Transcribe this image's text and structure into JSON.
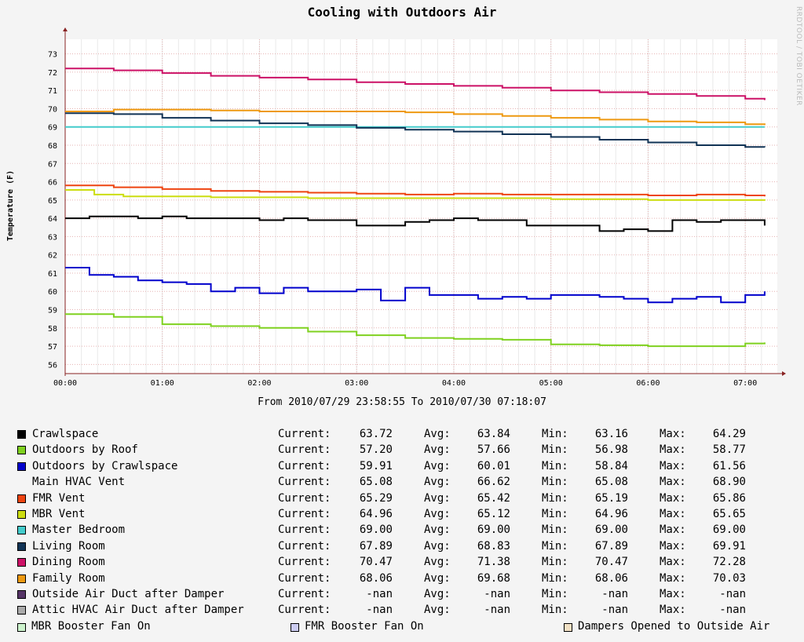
{
  "chart_data": {
    "type": "line",
    "title": "Cooling with Outdoors Air",
    "ylabel": "Temperature (F)",
    "xlabel": "",
    "ylim": [
      55.5,
      73.8
    ],
    "yticks": [
      56,
      57,
      58,
      59,
      60,
      61,
      62,
      63,
      64,
      65,
      66,
      67,
      68,
      69,
      70,
      71,
      72,
      73
    ],
    "xlim": [
      0,
      7.33
    ],
    "xticks": [
      {
        "label": "00:00",
        "value": 0
      },
      {
        "label": "01:00",
        "value": 1
      },
      {
        "label": "02:00",
        "value": 2
      },
      {
        "label": "03:00",
        "value": 3
      },
      {
        "label": "04:00",
        "value": 4
      },
      {
        "label": "05:00",
        "value": 5
      },
      {
        "label": "06:00",
        "value": 6
      },
      {
        "label": "07:00",
        "value": 7
      }
    ],
    "grid": true,
    "range_text": "From 2010/07/29 23:58:55 To 2010/07/30 07:18:07",
    "series": [
      {
        "name": "Crawlspace",
        "color": "#000000",
        "x": [
          0,
          0.25,
          0.5,
          0.75,
          1,
          1.25,
          1.5,
          1.75,
          2,
          2.25,
          2.5,
          2.75,
          3,
          3.25,
          3.5,
          3.75,
          4,
          4.25,
          4.5,
          4.75,
          5,
          5.25,
          5.5,
          5.75,
          6,
          6.25,
          6.5,
          6.75,
          7,
          7.2
        ],
        "y": [
          64.0,
          64.1,
          64.1,
          64.0,
          64.1,
          64.0,
          64.0,
          64.0,
          63.9,
          64.0,
          63.9,
          63.9,
          63.6,
          63.6,
          63.8,
          63.9,
          64.0,
          63.9,
          63.9,
          63.6,
          63.6,
          63.6,
          63.3,
          63.4,
          63.3,
          63.9,
          63.8,
          63.9,
          63.9,
          63.6
        ],
        "current": "63.72",
        "avg": "63.84",
        "min": "63.16",
        "max": "64.29"
      },
      {
        "name": "Outdoors by Roof",
        "color": "#7fd11f",
        "x": [
          0,
          0.5,
          1,
          1.5,
          2,
          2.5,
          3,
          3.5,
          4,
          4.5,
          5,
          5.5,
          6,
          6.5,
          7,
          7.2
        ],
        "y": [
          58.75,
          58.6,
          58.2,
          58.1,
          58.0,
          57.8,
          57.6,
          57.45,
          57.4,
          57.35,
          57.1,
          57.05,
          57.0,
          57.0,
          57.15,
          57.2
        ],
        "current": "57.20",
        "avg": "57.66",
        "min": "56.98",
        "max": "58.77"
      },
      {
        "name": "Outdoors by Crawlspace",
        "color": "#0000cc",
        "x": [
          0,
          0.25,
          0.5,
          0.75,
          1,
          1.25,
          1.5,
          1.75,
          2,
          2.25,
          2.5,
          2.75,
          3,
          3.25,
          3.5,
          3.75,
          4,
          4.25,
          4.5,
          4.75,
          5,
          5.25,
          5.5,
          5.75,
          6,
          6.25,
          6.5,
          6.75,
          7,
          7.2
        ],
        "y": [
          61.3,
          60.9,
          60.8,
          60.6,
          60.5,
          60.4,
          60.0,
          60.2,
          59.9,
          60.2,
          60.0,
          60.0,
          60.1,
          59.5,
          60.2,
          59.8,
          59.8,
          59.6,
          59.7,
          59.6,
          59.8,
          59.8,
          59.7,
          59.6,
          59.4,
          59.6,
          59.7,
          59.4,
          59.8,
          60.0
        ],
        "current": "59.91",
        "avg": "60.01",
        "min": "58.84",
        "max": "61.56"
      },
      {
        "name": "Main HVAC Vent",
        "color": "",
        "x": [],
        "y": [],
        "current": "65.08",
        "avg": "66.62",
        "min": "65.08",
        "max": "68.90"
      },
      {
        "name": "FMR Vent",
        "color": "#ee4411",
        "x": [
          0,
          0.5,
          1,
          1.5,
          2,
          2.5,
          3,
          3.5,
          4,
          4.5,
          5,
          5.5,
          6,
          6.5,
          7,
          7.2
        ],
        "y": [
          65.8,
          65.7,
          65.6,
          65.5,
          65.45,
          65.4,
          65.35,
          65.3,
          65.35,
          65.3,
          65.3,
          65.3,
          65.25,
          65.3,
          65.25,
          65.2
        ],
        "current": "65.29",
        "avg": "65.42",
        "min": "65.19",
        "max": "65.86"
      },
      {
        "name": "MBR Vent",
        "color": "#ccdd11",
        "x": [
          0,
          0.3,
          0.6,
          1,
          1.5,
          2,
          2.5,
          3,
          3.5,
          4,
          4.5,
          5,
          5.5,
          6,
          6.5,
          7,
          7.2
        ],
        "y": [
          65.55,
          65.3,
          65.2,
          65.2,
          65.15,
          65.15,
          65.1,
          65.1,
          65.1,
          65.1,
          65.1,
          65.05,
          65.05,
          65.0,
          65.0,
          65.0,
          64.96
        ],
        "current": "64.96",
        "avg": "65.12",
        "min": "64.96",
        "max": "65.65"
      },
      {
        "name": "Master Bedroom",
        "color": "#44cccc",
        "x": [
          0,
          7.2
        ],
        "y": [
          69.0,
          69.0
        ],
        "current": "69.00",
        "avg": "69.00",
        "min": "69.00",
        "max": "69.00"
      },
      {
        "name": "Living Room",
        "color": "#113355",
        "x": [
          0,
          0.5,
          1,
          1.5,
          2,
          2.5,
          3,
          3.5,
          4,
          4.5,
          5,
          5.5,
          6,
          6.5,
          7,
          7.2
        ],
        "y": [
          69.75,
          69.7,
          69.5,
          69.35,
          69.2,
          69.1,
          68.95,
          68.85,
          68.75,
          68.6,
          68.45,
          68.3,
          68.15,
          68.0,
          67.9,
          67.89
        ],
        "current": "67.89",
        "avg": "68.83",
        "min": "67.89",
        "max": "69.91"
      },
      {
        "name": "Dining Room",
        "color": "#cc1166",
        "x": [
          0,
          0.5,
          1,
          1.5,
          2,
          2.5,
          3,
          3.5,
          4,
          4.5,
          5,
          5.5,
          6,
          6.5,
          7,
          7.2
        ],
        "y": [
          72.2,
          72.1,
          71.95,
          71.8,
          71.7,
          71.6,
          71.45,
          71.35,
          71.25,
          71.15,
          71.0,
          70.9,
          70.8,
          70.7,
          70.55,
          70.47
        ],
        "current": "70.47",
        "avg": "71.38",
        "min": "70.47",
        "max": "72.28"
      },
      {
        "name": "Family Room",
        "color": "#ee9911",
        "x": [
          0,
          0.5,
          1,
          1.5,
          2,
          2.5,
          3,
          3.5,
          4,
          4.5,
          5,
          5.5,
          6,
          6.5,
          7,
          7.2
        ],
        "y": [
          69.85,
          69.95,
          69.95,
          69.9,
          69.85,
          69.85,
          69.85,
          69.8,
          69.7,
          69.6,
          69.5,
          69.4,
          69.3,
          69.25,
          69.15,
          69.1
        ],
        "current": "68.06",
        "avg": "69.68",
        "min": "68.06",
        "max": "70.03"
      },
      {
        "name": "Outside Air Duct after Damper",
        "color": "#553366",
        "x": [],
        "y": [],
        "current": "-nan",
        "avg": "-nan",
        "min": "-nan",
        "max": "-nan"
      },
      {
        "name": "Attic HVAC Air Duct after Damper",
        "color": "#aaaaaa",
        "x": [],
        "y": [],
        "current": "-nan",
        "avg": "-nan",
        "min": "-nan",
        "max": "-nan"
      }
    ],
    "extra_legend": [
      {
        "name": "MBR Booster Fan On",
        "color": "#ccf2cc"
      },
      {
        "name": "FMR Booster Fan On",
        "color": "#ccccf2"
      },
      {
        "name": "Dampers Opened to Outside Air",
        "color": "#f2e0c4"
      }
    ]
  },
  "labels": {
    "current": "Current:",
    "avg": "Avg:",
    "min": "Min:",
    "max": "Max:"
  },
  "watermark": "RRDTOOL / TOBI OETIKER",
  "colors": {
    "background": "#f4f4f4",
    "plot_background": "#ffffff",
    "grid": "#e6b3b3",
    "axis": "#882222"
  }
}
